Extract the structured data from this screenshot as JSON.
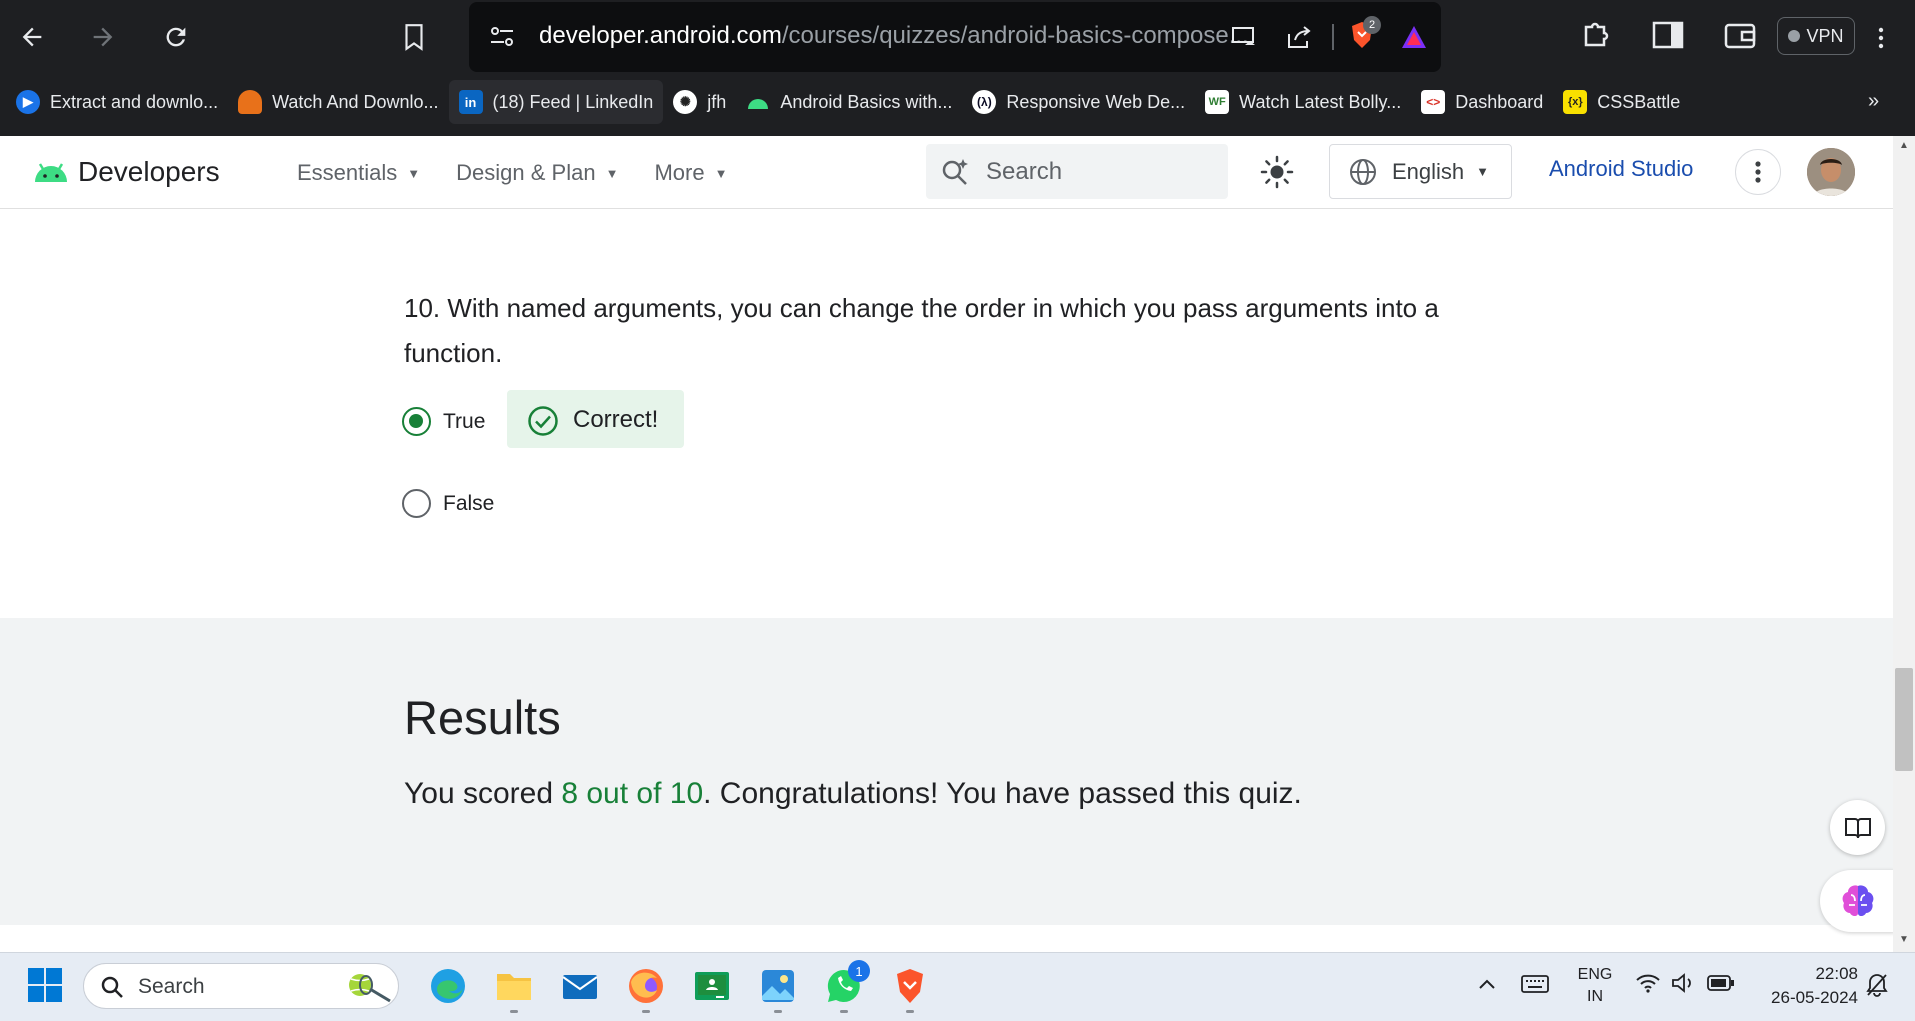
{
  "browser": {
    "url_host": "developer.android.com",
    "url_path": "/courses/quizzes/android-basics-compose...",
    "brave_badge": "2",
    "vpn_label": "VPN",
    "bookmarks": [
      {
        "label": "Extract and downlo...",
        "icon": "play-circle-icon",
        "color": "#1a73e8"
      },
      {
        "label": "Watch And Downlo...",
        "icon": "hat-icon",
        "color": "#e8711a"
      },
      {
        "label": "(18) Feed | LinkedIn",
        "icon": "linkedin-icon",
        "color": "#0a66c2"
      },
      {
        "label": "jfh",
        "icon": "openai-icon",
        "color": "#555"
      },
      {
        "label": "Android Basics with...",
        "icon": "android-icon",
        "color": "#3ddc84"
      },
      {
        "label": "Responsive Web De...",
        "icon": "fcc-icon",
        "color": "#0a0a23"
      },
      {
        "label": "Watch Latest Bolly...",
        "icon": "wf-icon",
        "color": "#2e7d32"
      },
      {
        "label": "Dashboard",
        "icon": "code-icon",
        "color": "#ffffff"
      },
      {
        "label": "CSSBattle",
        "icon": "cssbattle-icon",
        "color": "#f9e000"
      }
    ]
  },
  "site": {
    "brand": "Developers",
    "nav": [
      "Essentials",
      "Design & Plan",
      "More"
    ],
    "search_placeholder": "Search",
    "language": "English",
    "studio_link": "Android Studio"
  },
  "question": {
    "text": "10. With named arguments, you can change the order in which you pass arguments into a function.",
    "options": [
      {
        "label": "True",
        "checked": true
      },
      {
        "label": "False",
        "checked": false
      }
    ],
    "feedback": "Correct!"
  },
  "results": {
    "title": "Results",
    "prefix": "You scored ",
    "score": "8 out of 10",
    "suffix": ". Congratulations! You have passed this quiz."
  },
  "taskbar": {
    "search_placeholder": "Search",
    "whatsapp_badge": "1",
    "lang_line1": "ENG",
    "lang_line2": "IN",
    "time": "22:08",
    "date": "26-05-2024"
  }
}
